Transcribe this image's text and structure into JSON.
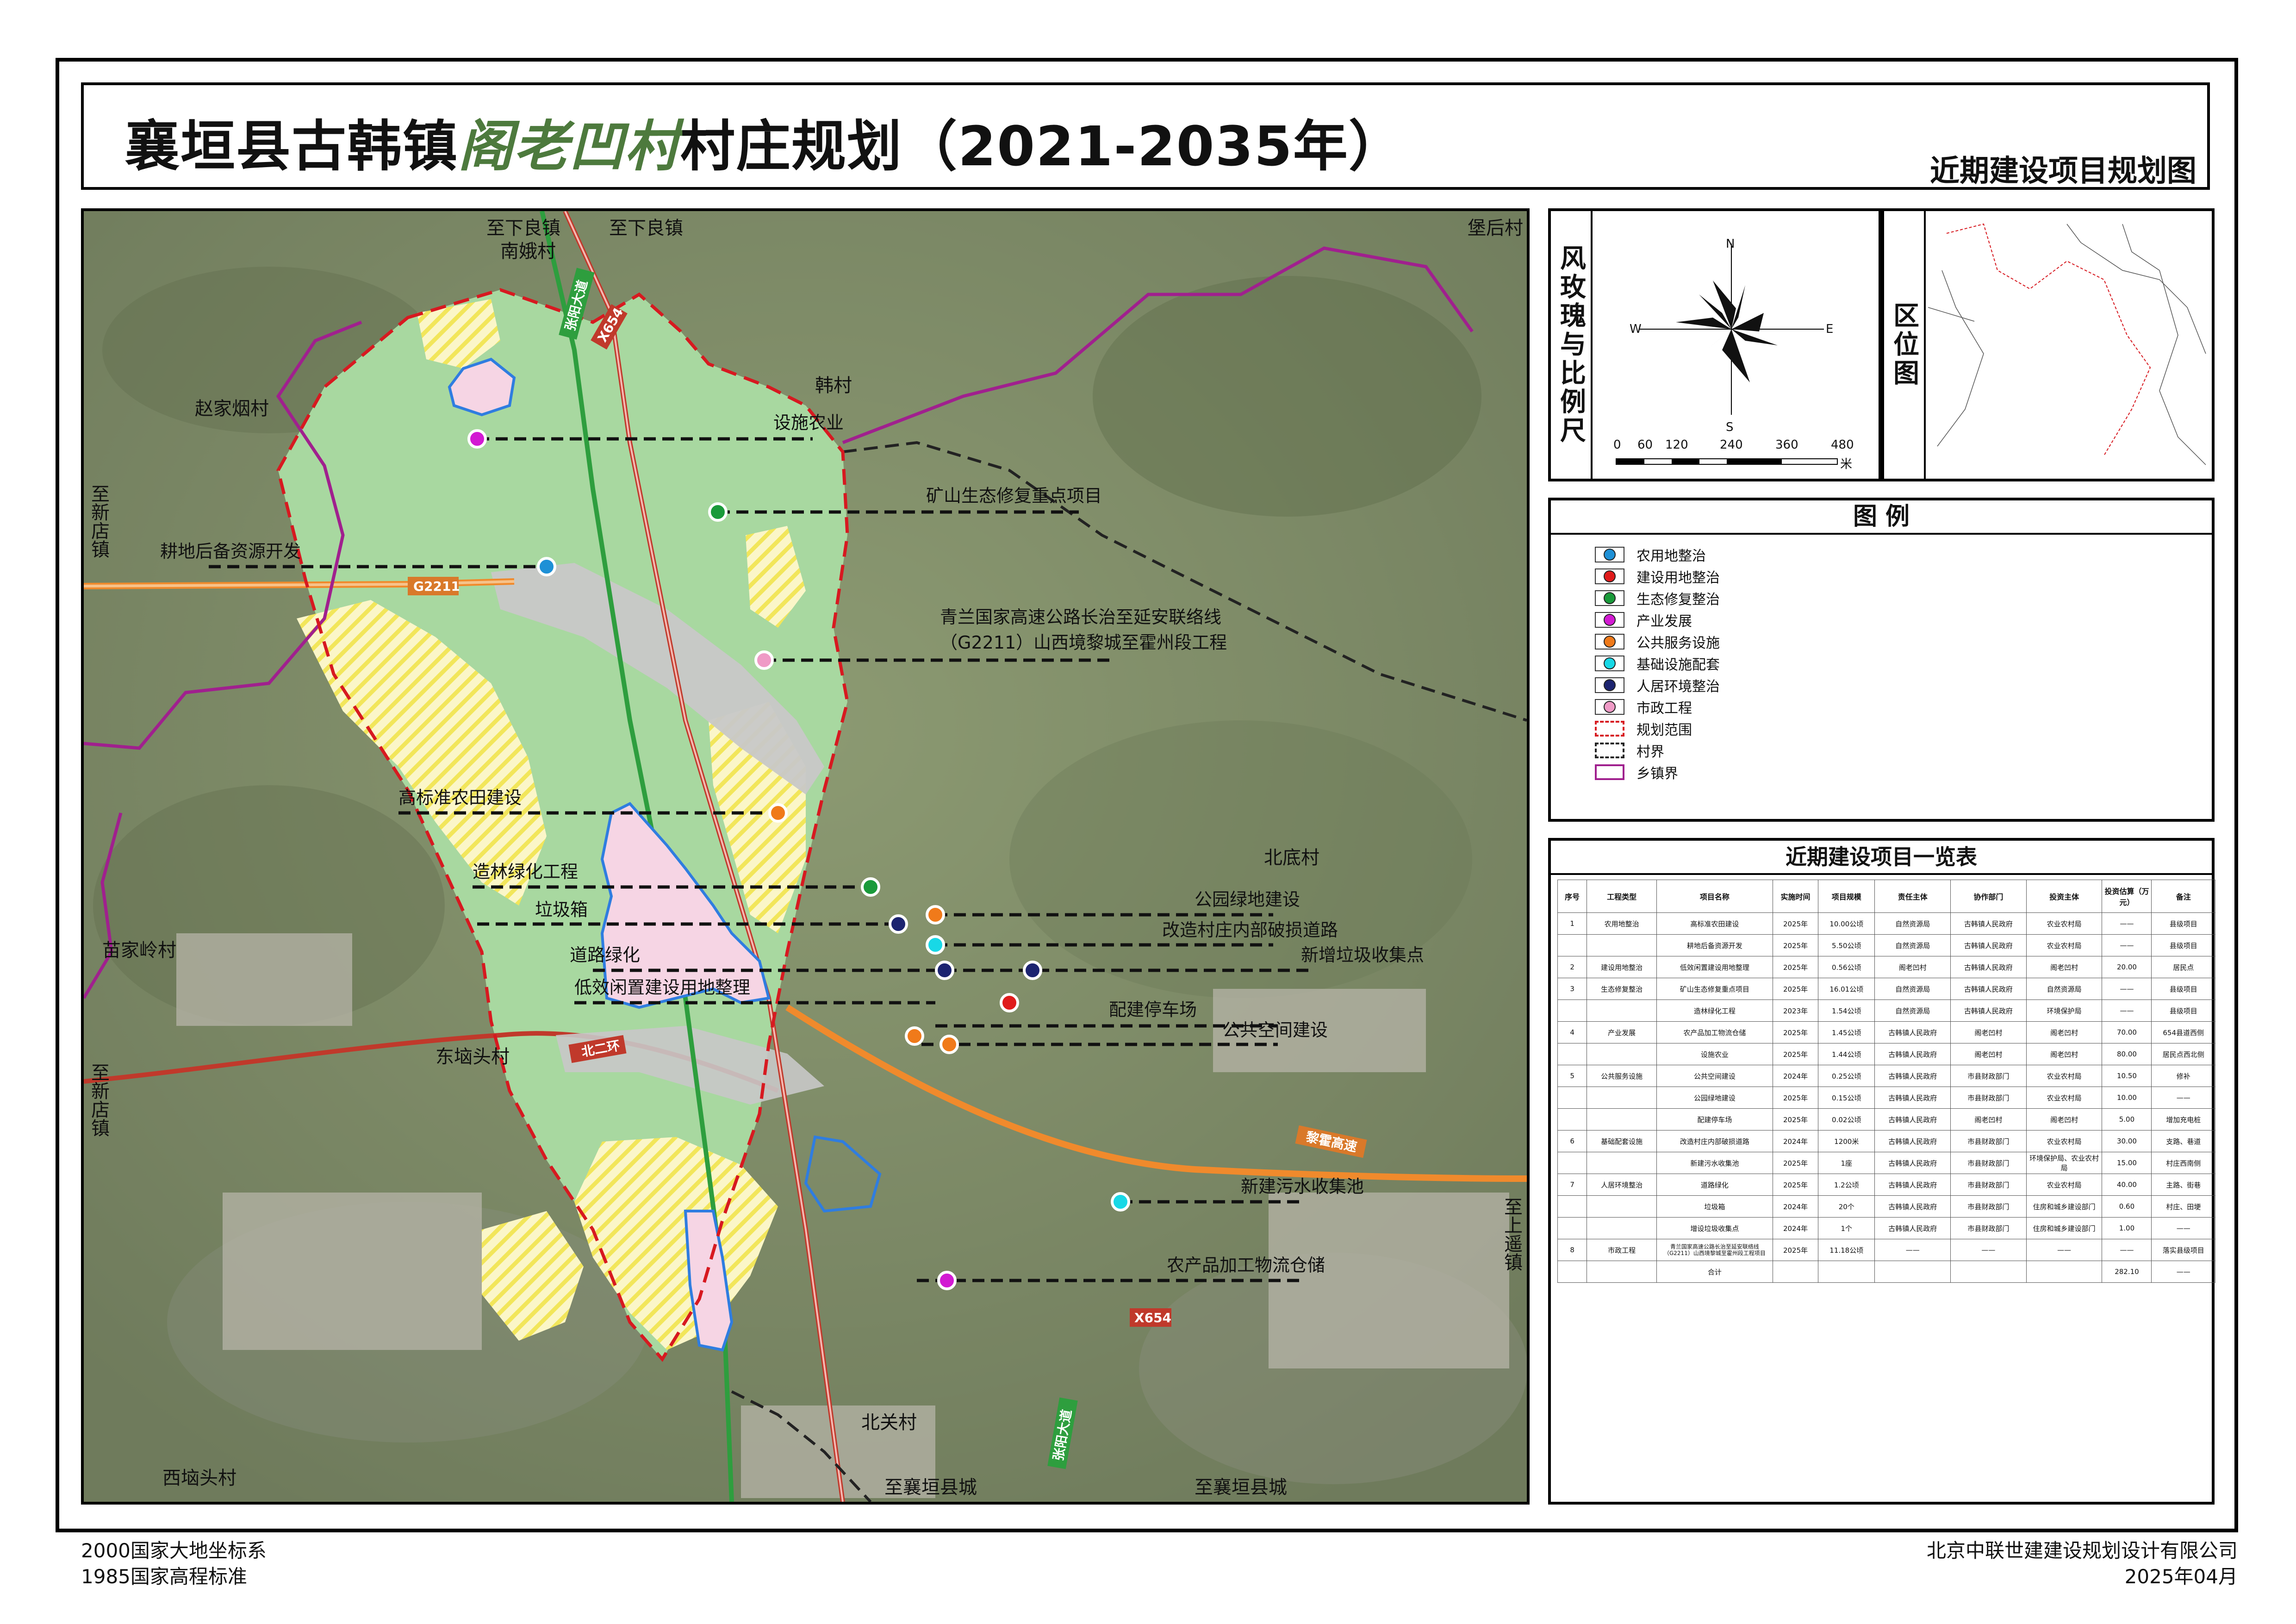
{
  "title": {
    "prefix": "襄垣县古韩镇",
    "village": "阁老凹村",
    "suffix": "村庄规划（2021-2035年）",
    "subtitle": "近期建设项目规划图"
  },
  "colors": {
    "planning_boundary": "#d71920",
    "village_boundary": "#222222",
    "township_boundary": "#a0208e",
    "construction_land": "#f6d5e4",
    "ecological_land": "#a8d8a0",
    "farmland_hatch": "#f2e65a",
    "road_gray": "#c8c8c8",
    "expressway": "#f08a2c",
    "provincial_road": "#c0392b"
  },
  "map": {
    "place_labels": {
      "xialiang_north": "至下良镇",
      "nane": "南娥村",
      "xialiang_north2": "至下良镇",
      "baohou": "堡后村",
      "zhaojiayan": "赵家烟村",
      "hancun": "韩村",
      "xindian_1": "至新店镇",
      "beidi": "北底村",
      "miaojialing": "苗家岭村",
      "dongyuantou": "东垴头村",
      "xindian_2": "至新店镇",
      "shangyao": "至上遥镇",
      "beiguan": "北关村",
      "xiyuantou": "西垴头村",
      "xiangyuan_1": "至襄垣县城",
      "xiangyuan_2": "至襄垣县城"
    },
    "road_labels": {
      "g2211": "G2211",
      "x654_top": "X654",
      "x654_bottom": "X654",
      "beierhuan": "北二环",
      "xiangyuan_gaosu": "黎霍高速",
      "zhangyang_north": "张阳大道",
      "zhangyang_south": "张阳大道"
    },
    "project_labels": {
      "sheshi_nongye": "设施农业",
      "kuangshan": "矿山生态修复重点项目",
      "gengdi": "耕地后备资源开发",
      "qinglan_1": "青兰国家高速公路长治至延安联络线",
      "qinglan_2": "（G2211）山西境黎城至霍州段工程",
      "gaobiaozhun": "高标准农田建设",
      "zaolin": "造林绿化工程",
      "gongyuan": "公园绿地建设",
      "lajixiang": "垃圾箱",
      "gaizao": "改造村庄内部破损道路",
      "daolu_lvhua": "道路绿化",
      "xinzeng_laji": "新增垃圾收集点",
      "dixiao": "低效闲置建设用地整理",
      "tingche": "配建停车场",
      "gonggong": "公共空间建设",
      "wushui": "新建污水收集池",
      "nongchanpin": "农产品加工物流仓储"
    }
  },
  "wind_rose": {
    "label": "风玫瑰与比例尺",
    "north": "N",
    "south": "S",
    "east": "E",
    "west": "W",
    "scale_ticks": [
      "0",
      "60",
      "120",
      "240",
      "360",
      "480"
    ],
    "scale_unit": "米"
  },
  "location_map": {
    "label": "区位图"
  },
  "legend": {
    "title": "图 例",
    "items": [
      {
        "label": "农用地整治",
        "color": "#1e90d6",
        "kind": "dot"
      },
      {
        "label": "建设用地整治",
        "color": "#e01b1b",
        "kind": "dot"
      },
      {
        "label": "生态修复整治",
        "color": "#1a9a3a",
        "kind": "dot"
      },
      {
        "label": "产业发展",
        "color": "#d21ad2",
        "kind": "dot"
      },
      {
        "label": "公共服务设施",
        "color": "#f07a1a",
        "kind": "dot"
      },
      {
        "label": "基础设施配套",
        "color": "#18d8e6",
        "kind": "dot"
      },
      {
        "label": "人居环境整治",
        "color": "#1c2470",
        "kind": "dot"
      },
      {
        "label": "市政工程",
        "color": "#ef9ac6",
        "kind": "dot"
      },
      {
        "label": "规划范围",
        "color": "#d71920",
        "kind": "dash"
      },
      {
        "label": "村界",
        "color": "#222222",
        "kind": "dash"
      },
      {
        "label": "乡镇界",
        "color": "#a0208e",
        "kind": "solid"
      }
    ]
  },
  "project_table": {
    "title": "近期建设项目一览表",
    "headers": [
      "序号",
      "工程类型",
      "项目名称",
      "实施时间",
      "项目规模",
      "责任主体",
      "协作部门",
      "投资主体",
      "投资估算（万元）",
      "备注"
    ],
    "rows": [
      [
        "1",
        "农用地整治",
        "高标准农田建设",
        "2025年",
        "10.00公顷",
        "自然资源局",
        "古韩镇人民政府",
        "农业农村局",
        "——",
        "县级项目"
      ],
      [
        "",
        "",
        "耕地后备资源开发",
        "2025年",
        "5.50公顷",
        "自然资源局",
        "古韩镇人民政府",
        "农业农村局",
        "——",
        "县级项目"
      ],
      [
        "2",
        "建设用地整治",
        "低效闲置建设用地整理",
        "2025年",
        "0.56公顷",
        "阁老凹村",
        "古韩镇人民政府",
        "阁老凹村",
        "20.00",
        "居民点"
      ],
      [
        "3",
        "生态修复整治",
        "矿山生态修复重点项目",
        "2025年",
        "16.01公顷",
        "自然资源局",
        "古韩镇人民政府",
        "自然资源局",
        "——",
        "县级项目"
      ],
      [
        "",
        "",
        "造林绿化工程",
        "2023年",
        "1.54公顷",
        "自然资源局",
        "古韩镇人民政府",
        "环境保护局",
        "——",
        "县级项目"
      ],
      [
        "4",
        "产业发展",
        "农产品加工物流仓储",
        "2025年",
        "1.45公顷",
        "古韩镇人民政府",
        "阁老凹村",
        "阁老凹村",
        "70.00",
        "654县道西侧"
      ],
      [
        "",
        "",
        "设施农业",
        "2025年",
        "1.44公顷",
        "古韩镇人民政府",
        "阁老凹村",
        "阁老凹村",
        "80.00",
        "居民点西北侧"
      ],
      [
        "5",
        "公共服务设施",
        "公共空间建设",
        "2024年",
        "0.25公顷",
        "古韩镇人民政府",
        "市县财政部门",
        "农业农村局",
        "10.50",
        "修补"
      ],
      [
        "",
        "",
        "公园绿地建设",
        "2025年",
        "0.15公顷",
        "古韩镇人民政府",
        "市县财政部门",
        "农业农村局",
        "10.00",
        "——"
      ],
      [
        "",
        "",
        "配建停车场",
        "2025年",
        "0.02公顷",
        "古韩镇人民政府",
        "阁老凹村",
        "阁老凹村",
        "5.00",
        "增加充电桩"
      ],
      [
        "6",
        "基础配套设施",
        "改造村庄内部破损道路",
        "2024年",
        "1200米",
        "古韩镇人民政府",
        "市县财政部门",
        "农业农村局",
        "30.00",
        "支路、巷道"
      ],
      [
        "",
        "",
        "新建污水收集池",
        "2025年",
        "1座",
        "古韩镇人民政府",
        "市县财政部门",
        "环境保护局、农业农村局",
        "15.00",
        "村庄西南侧"
      ],
      [
        "7",
        "人居环境整治",
        "道路绿化",
        "2025年",
        "1.2公顷",
        "古韩镇人民政府",
        "市县财政部门",
        "农业农村局",
        "40.00",
        "主路、街巷"
      ],
      [
        "",
        "",
        "垃圾箱",
        "2024年",
        "20个",
        "古韩镇人民政府",
        "市县财政部门",
        "住房和城乡建设部门",
        "0.60",
        "村庄、田埂"
      ],
      [
        "",
        "",
        "增设垃圾收集点",
        "2024年",
        "1个",
        "古韩镇人民政府",
        "市县财政部门",
        "住房和城乡建设部门",
        "1.00",
        "——"
      ],
      [
        "8",
        "市政工程",
        "青兰国家高速公路长治至延安联络线（G2211）山西境黎城至霍州段工程项目",
        "2025年",
        "11.18公顷",
        "——",
        "——",
        "——",
        "——",
        "落实县级项目"
      ],
      [
        "",
        "",
        "合计",
        "",
        "",
        "",
        "",
        "",
        "282.10",
        "——"
      ]
    ]
  },
  "footer": {
    "coord_system": "2000国家大地坐标系",
    "elevation": "1985国家高程标准",
    "company": "北京中联世建建设规划设计有限公司",
    "date": "2025年04月"
  }
}
